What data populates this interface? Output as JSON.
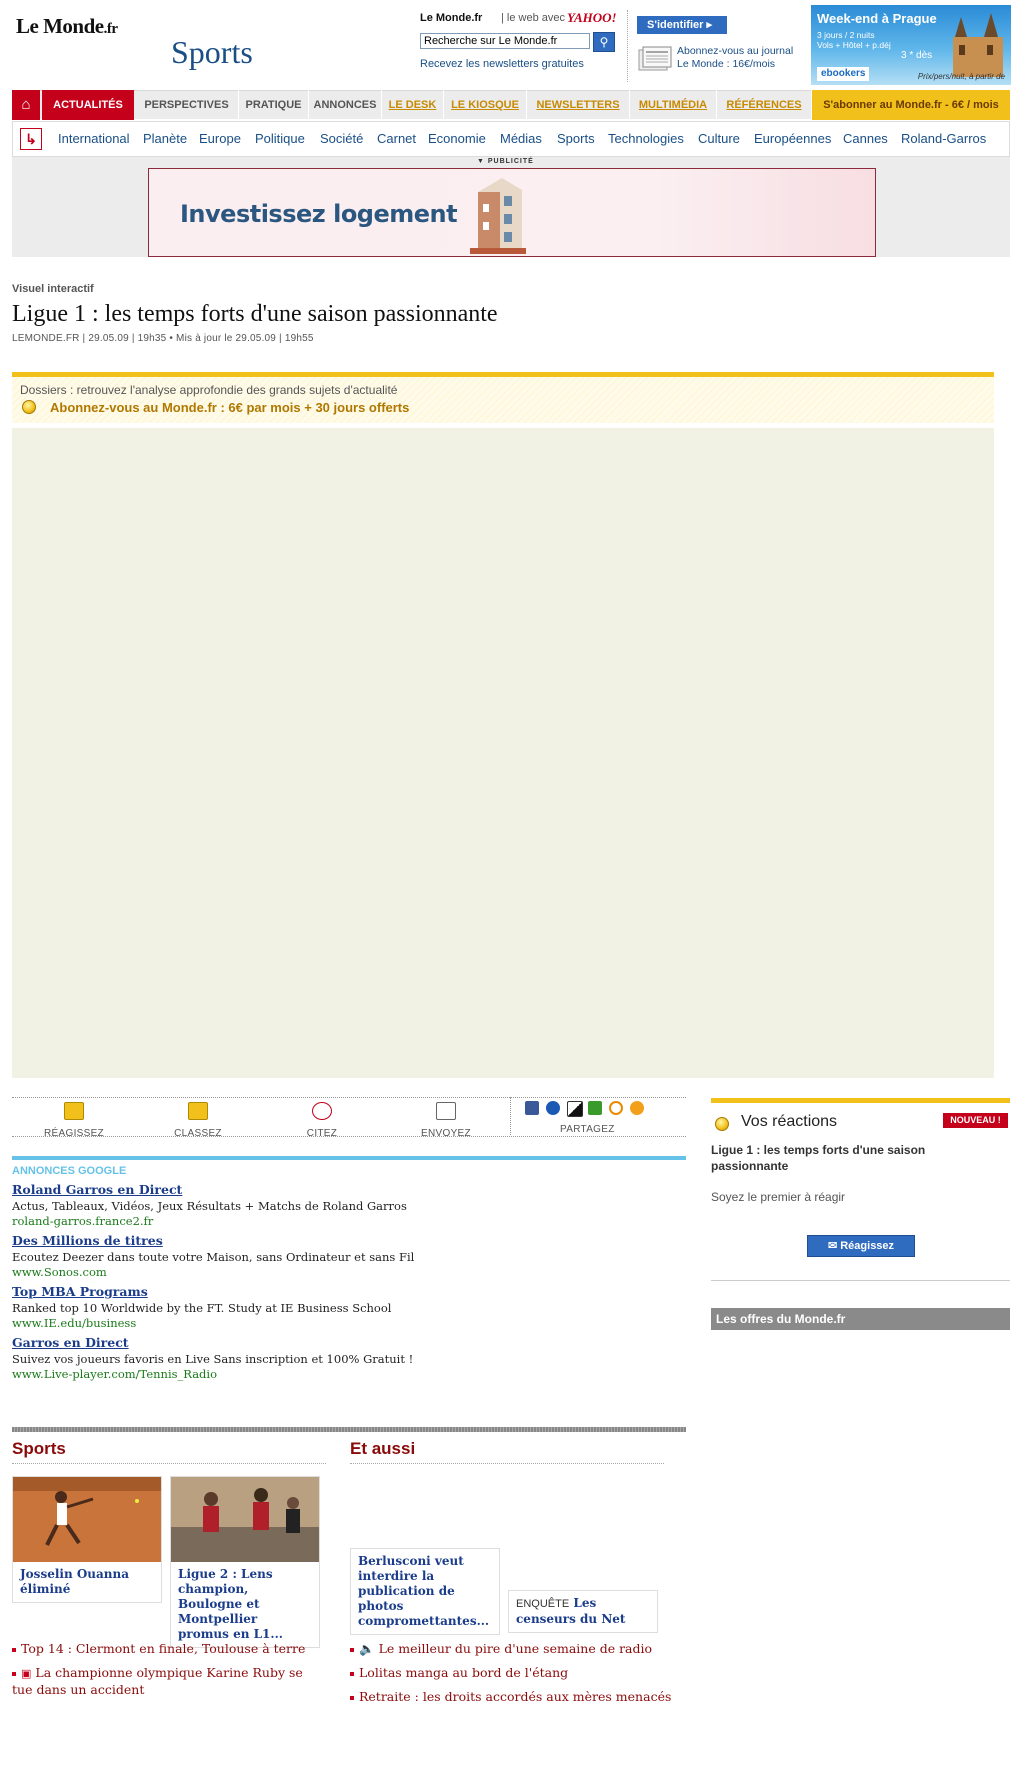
{
  "header": {
    "logo": "Le Monde",
    "logo_suffix": ".fr",
    "section": "Sports",
    "site_label": "Le Monde.fr",
    "web_avec": "| le web avec",
    "yahoo": "YAHOO!",
    "search_value": "Recherche sur Le Monde.fr",
    "newsletter": "Recevez les newsletters gratuites",
    "login": "S'identifier",
    "journal_line1": "Abonnez-vous au journal",
    "journal_line2": "Le Monde : 16€/mois"
  },
  "ad_prague": {
    "title": "Week-end à Prague",
    "line1": "3 jours / 2 nuits",
    "line2": "Vols + Hôtel + p.déj",
    "price": "3 * dès",
    "brand": "ebookers",
    "footer": "Prix/pers/nuit, à partir de"
  },
  "nav": {
    "active": "ACTUALITÉS",
    "tabs": [
      "PERSPECTIVES",
      "PRATIQUE",
      "ANNONCES",
      "LE DESK",
      "LE KIOSQUE",
      "NEWSLETTERS",
      "MULTIMÉDIA",
      "RÉFÉRENCES"
    ],
    "abonner": "S'abonner au Monde.fr - 6€ / mois",
    "sub": [
      "International",
      "Planète",
      "Europe",
      "Politique",
      "Société",
      "Carnet",
      "Economie",
      "Médias",
      "Sports",
      "Technologies",
      "Culture",
      "Européennes",
      "Cannes",
      "Roland-Garros"
    ]
  },
  "publicite": {
    "label": "▼ PUBLICITÉ",
    "banner_text": "Investissez logement"
  },
  "article": {
    "kicker": "Visuel interactif",
    "title": "Ligue 1 : les temps forts d'une saison passionnante",
    "dateline": "LEMONDE.FR | 29.05.09 | 19h35  •  Mis à jour le 29.05.09 | 19h55",
    "dossiers": "Dossiers : retrouvez l'analyse approfondie des grands sujets d'actualité",
    "abonnez": "Abonnez-vous au Monde.fr : 6€ par mois + 30 jours offerts"
  },
  "toolbar": {
    "reagissez": "RÉAGISSEZ",
    "classez": "CLASSEZ",
    "citez": "CITEZ",
    "envoyez": "ENVOYEZ",
    "partagez": "PARTAGEZ"
  },
  "google_ads": {
    "title": "ANNONCES GOOGLE",
    "items": [
      {
        "title": "Roland Garros en Direct",
        "desc": "Actus, Tableaux, Vidéos, Jeux Résultats + Matchs de Roland Garros",
        "url": "roland-garros.france2.fr"
      },
      {
        "title": "Des Millions de titres",
        "desc": "Ecoutez Deezer dans toute votre Maison, sans Ordinateur et sans Fil",
        "url": "www.Sonos.com"
      },
      {
        "title": "Top MBA Programs",
        "desc": "Ranked top 10 Worldwide by the FT. Study at IE Business School",
        "url": "www.IE.edu/business"
      },
      {
        "title": "Garros en Direct",
        "desc": "Suivez vos joueurs favoris en Live Sans inscription et 100% Gratuit !",
        "url": "www.Live-player.com/Tennis_Radio"
      }
    ]
  },
  "reactions": {
    "title": "Vos réactions",
    "badge": "NOUVEAU !",
    "article": "Ligue 1 : les temps forts d'une saison passionnante",
    "first": "Soyez le premier à réagir",
    "button": "Réagissez",
    "offres": "Les offres du Monde.fr"
  },
  "bottom": {
    "sports_head": "Sports",
    "aussi_head": "Et aussi",
    "cards": [
      {
        "caption": "Josselin Ouanna éliminé",
        "pre": ""
      },
      {
        "caption": "Ligue 2 : Lens champion, Boulogne et Montpellier promus en L1...",
        "pre": ""
      },
      {
        "caption": "Berlusconi veut interdire la publication de photos compromettantes...",
        "pre": ""
      },
      {
        "caption": "Les censeurs du Net",
        "pre": "ENQUÊTE"
      }
    ],
    "sports_links": [
      "Top 14 : Clermont en finale, Toulouse à terre",
      "La championne olympique Karine Ruby se tue dans un accident"
    ],
    "aussi_links": [
      "Le meilleur du pire d'une semaine de radio",
      "Lolitas manga au bord de l'étang",
      "Retraite : les droits accordés aux mères menacés"
    ]
  }
}
